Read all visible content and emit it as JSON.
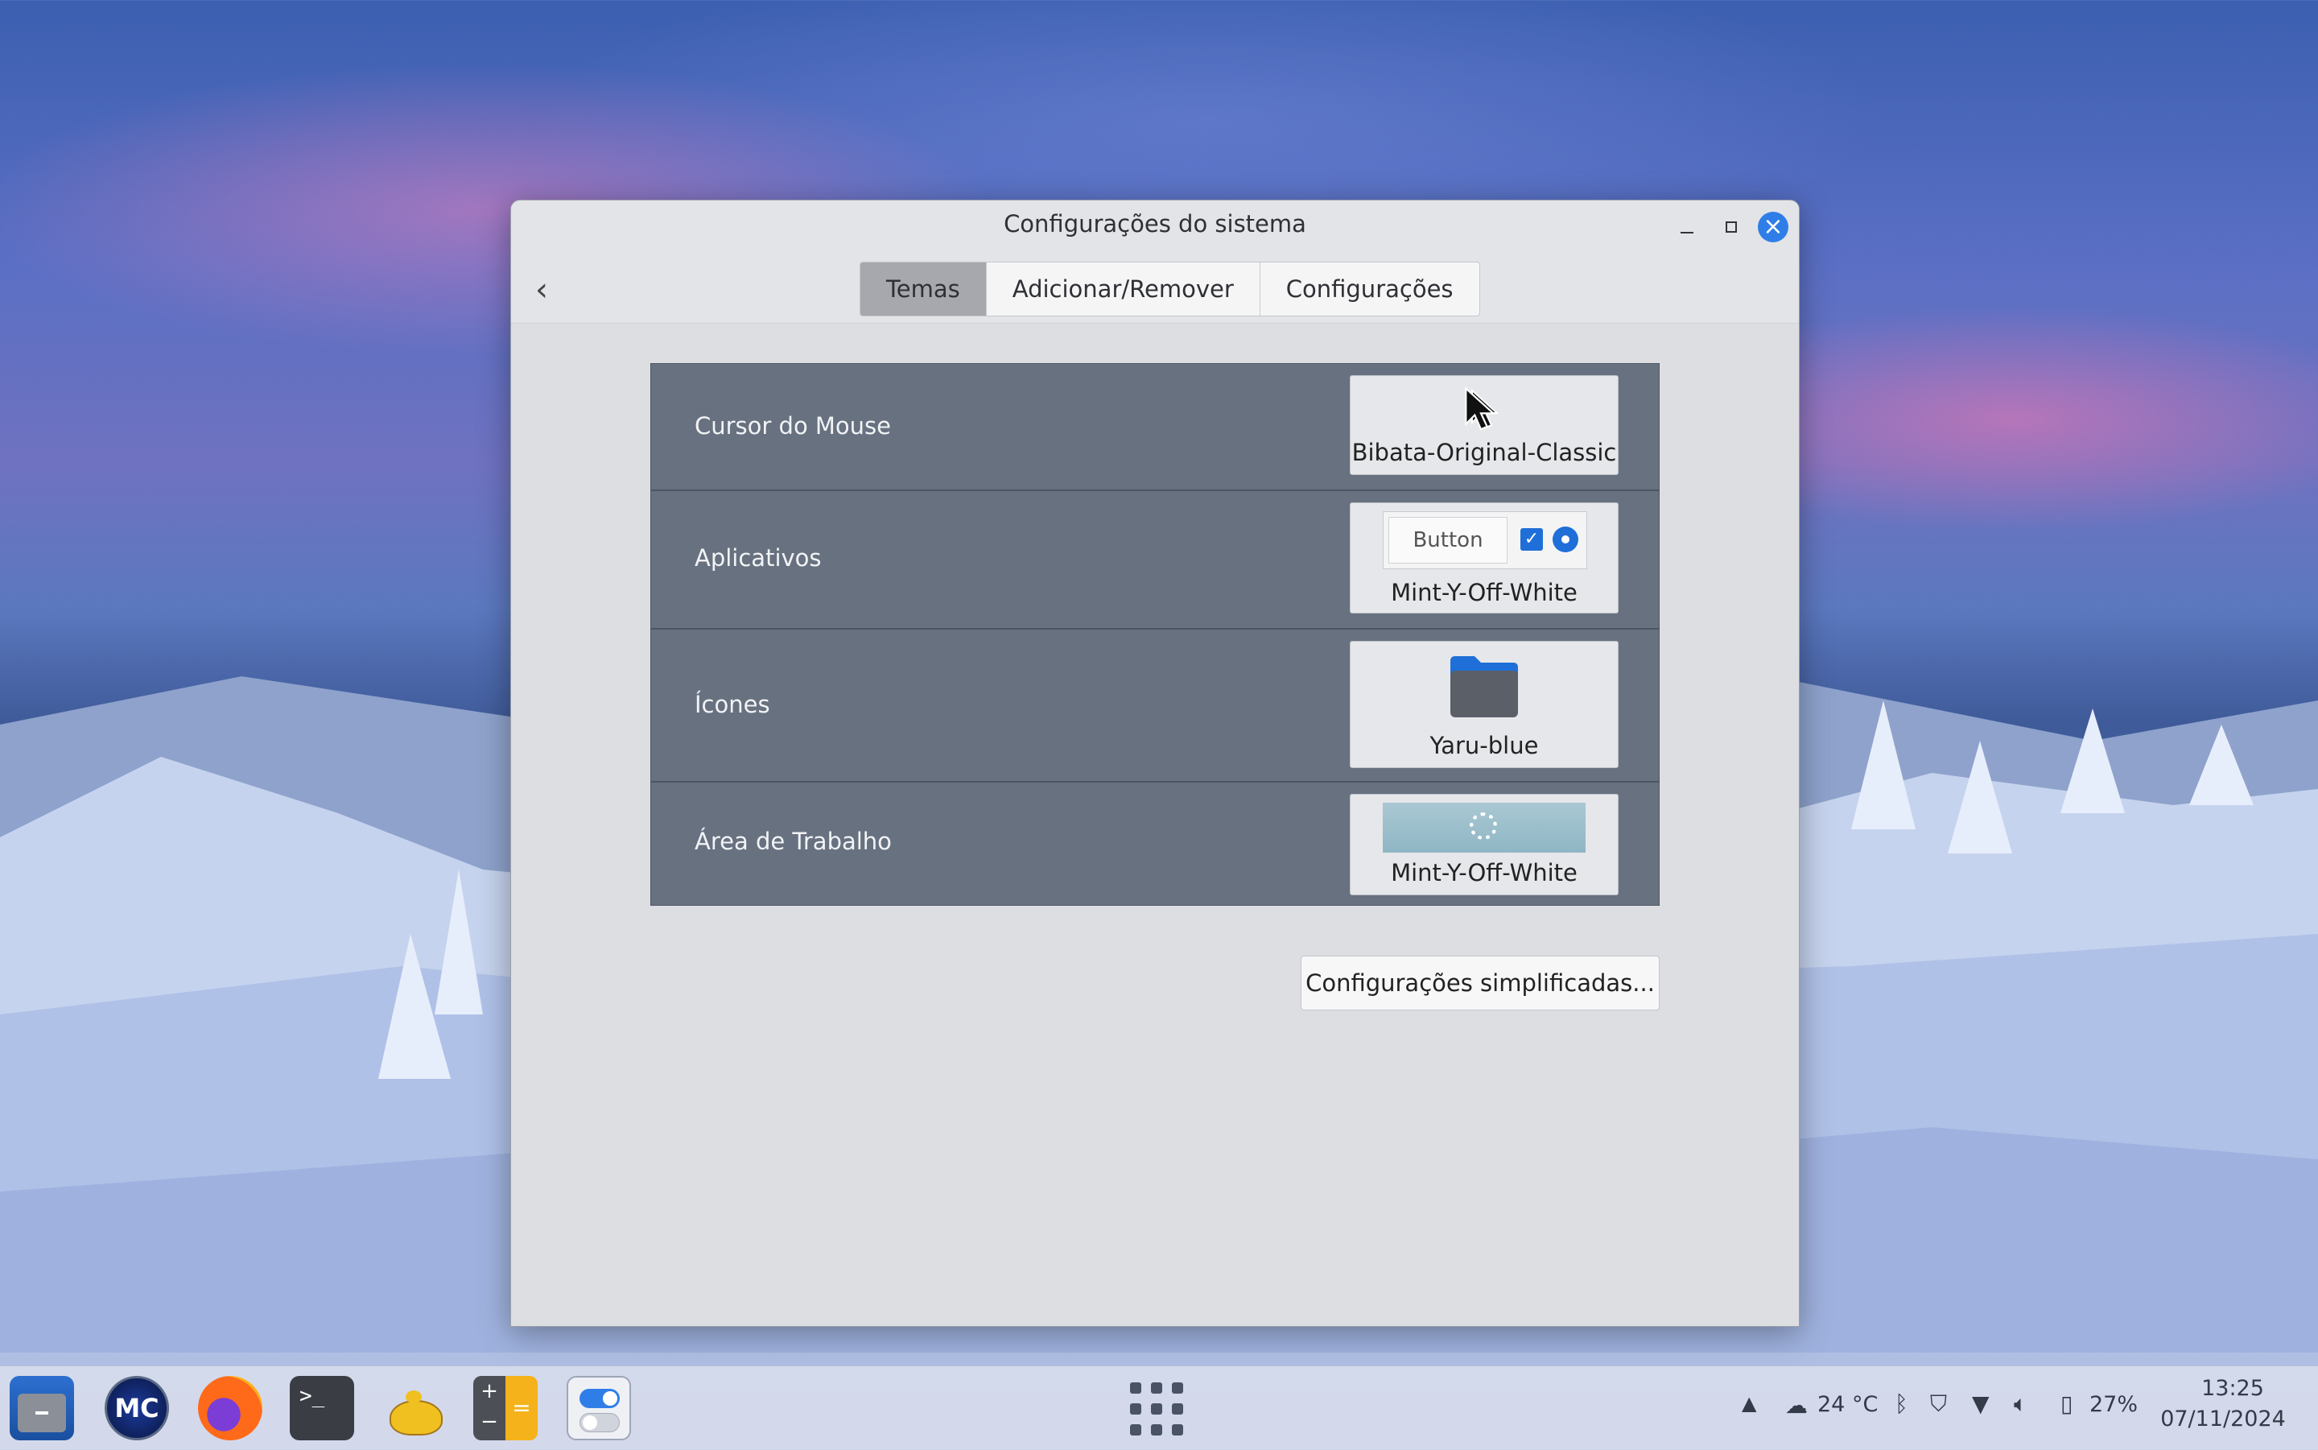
{
  "window": {
    "title": "Configurações do sistema",
    "tabs": [
      {
        "label": "Temas",
        "active": true
      },
      {
        "label": "Adicionar/Remover",
        "active": false
      },
      {
        "label": "Configurações",
        "active": false
      }
    ]
  },
  "themes": {
    "rows": [
      {
        "label": "Cursor do Mouse",
        "value": "Bibata-Original-Classic"
      },
      {
        "label": "Aplicativos",
        "value": "Mint-Y-Off-White",
        "preview_button": "Button"
      },
      {
        "label": "Ícones",
        "value": "Yaru-blue"
      },
      {
        "label": "Área de Trabalho",
        "value": "Mint-Y-Off-White"
      }
    ],
    "simplified_button": "Configurações simplificadas..."
  },
  "taskbar": {
    "apps": [
      "files-icon",
      "mc-icon",
      "firefox-icon",
      "terminal-icon",
      "genie-lamp-icon",
      "calculator-icon",
      "settings-toggle-icon"
    ],
    "weather": "24 °C",
    "battery": "27%",
    "time": "13:25",
    "date": "07/11/2024"
  },
  "colors": {
    "accent": "#2f7ee8",
    "panel": "#677180",
    "folder_blue": "#1f6fd8"
  }
}
